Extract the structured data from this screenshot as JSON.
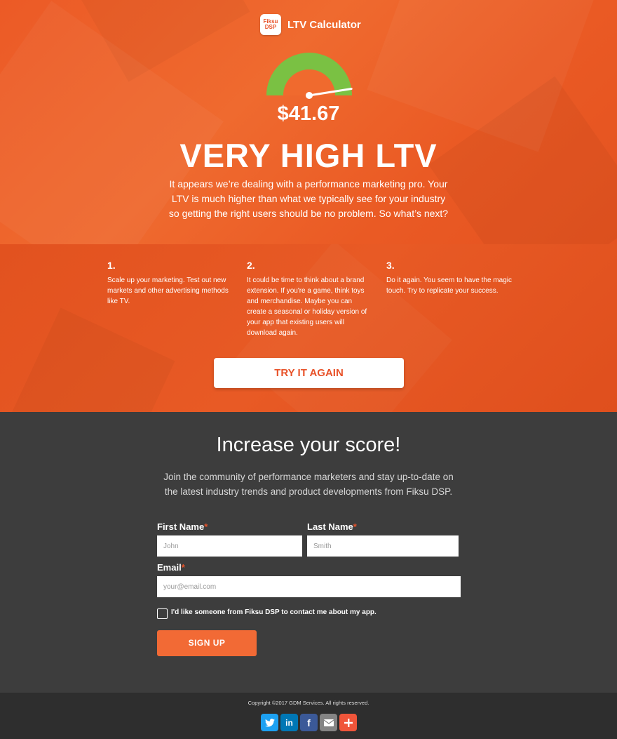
{
  "brand": {
    "logo_line1": "Fiksu",
    "logo_line2": "DSP",
    "title": "LTV Calculator"
  },
  "result": {
    "gauge_level": 0.95,
    "price": "$41.67",
    "headline": "VERY HIGH LTV",
    "description": "It appears we’re dealing with a performance marketing pro. Your LTV is much higher than what we typically see for your industry so getting the right users should be no problem. So what’s next?"
  },
  "steps": [
    {
      "number": "1.",
      "text": "Scale up your marketing. Test out new markets and other advertising methods like TV."
    },
    {
      "number": "2.",
      "text": "It could be time to think about a brand extension. If you're a game, think toys and merchandise. Maybe you can create a seasonal or holiday version of your app that existing users will download again."
    },
    {
      "number": "3.",
      "text": "Do it again. You seem to have the magic touch. Try to replicate your success."
    }
  ],
  "try_again_label": "TRY IT AGAIN",
  "signup": {
    "title": "Increase your score!",
    "description": "Join the community of performance marketers and stay up-to-date on the latest industry trends and product developments from Fiksu DSP.",
    "first_name_label": "First Name",
    "first_name_placeholder": "John",
    "last_name_label": "Last Name",
    "last_name_placeholder": "Smith",
    "email_label": "Email",
    "email_placeholder": "your@email.com",
    "required_mark": "*",
    "checkbox_label": "I'd like someone from Fiksu DSP to contact me about my app.",
    "checkbox_checked": false,
    "button_label": "SIGN UP"
  },
  "footer": {
    "copyright": "Copyright ©2017 GDM Services. All rights reserved.",
    "share_icons": [
      {
        "name": "twitter-icon",
        "color": "#1da1f2"
      },
      {
        "name": "linkedin-icon",
        "color": "#0077b5"
      },
      {
        "name": "facebook-icon",
        "color": "#3b5998"
      },
      {
        "name": "email-icon",
        "color": "#848484"
      },
      {
        "name": "more-share-icon",
        "color": "#f0553a"
      }
    ]
  },
  "colors": {
    "accent": "#e8532a",
    "dark_bg": "#3d3d3d",
    "footer_bg": "#2e2e2e",
    "gauge_green": "#7ac143"
  }
}
